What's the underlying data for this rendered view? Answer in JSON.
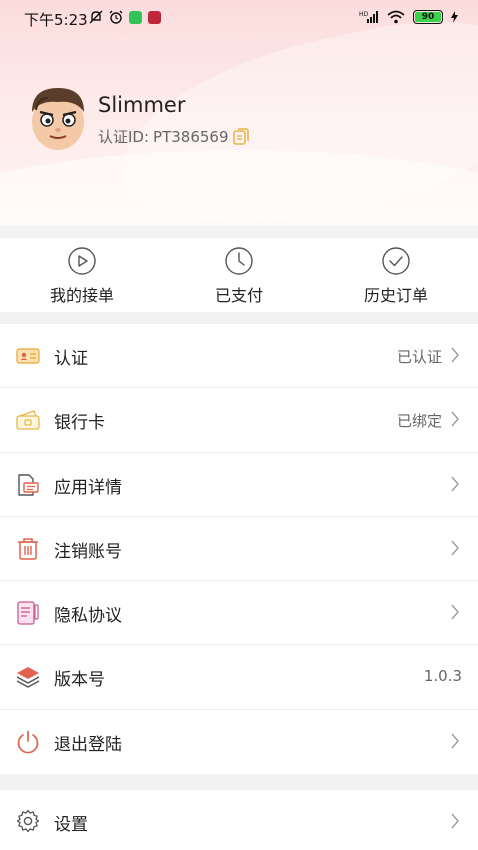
{
  "status_bar": {
    "time": "下午5:23",
    "battery": "90",
    "network": "HD"
  },
  "profile": {
    "username": "Slimmer",
    "cert_label": "认证ID:",
    "cert_id": "PT386569"
  },
  "quick_tabs": [
    {
      "label": "我的接单",
      "icon": "play-circle-icon"
    },
    {
      "label": "已支付",
      "icon": "clock-icon"
    },
    {
      "label": "历史订单",
      "icon": "check-circle-icon"
    }
  ],
  "menu": [
    {
      "label": "认证",
      "value": "已认证",
      "icon": "id-card-icon"
    },
    {
      "label": "银行卡",
      "value": "已绑定",
      "icon": "bank-card-icon"
    },
    {
      "label": "应用详情",
      "value": "",
      "icon": "app-detail-icon"
    },
    {
      "label": "注销账号",
      "value": "",
      "icon": "trash-icon"
    },
    {
      "label": "隐私协议",
      "value": "",
      "icon": "document-icon"
    },
    {
      "label": "版本号",
      "value": "1.0.3",
      "icon": "layers-icon"
    },
    {
      "label": "退出登陆",
      "value": "",
      "icon": "power-icon"
    }
  ],
  "settings": {
    "label": "设置",
    "icon": "gear-icon"
  },
  "colors": {
    "accent": "#e0624f",
    "gold": "#e8b64a",
    "header_pink": "#fbdcdc"
  }
}
